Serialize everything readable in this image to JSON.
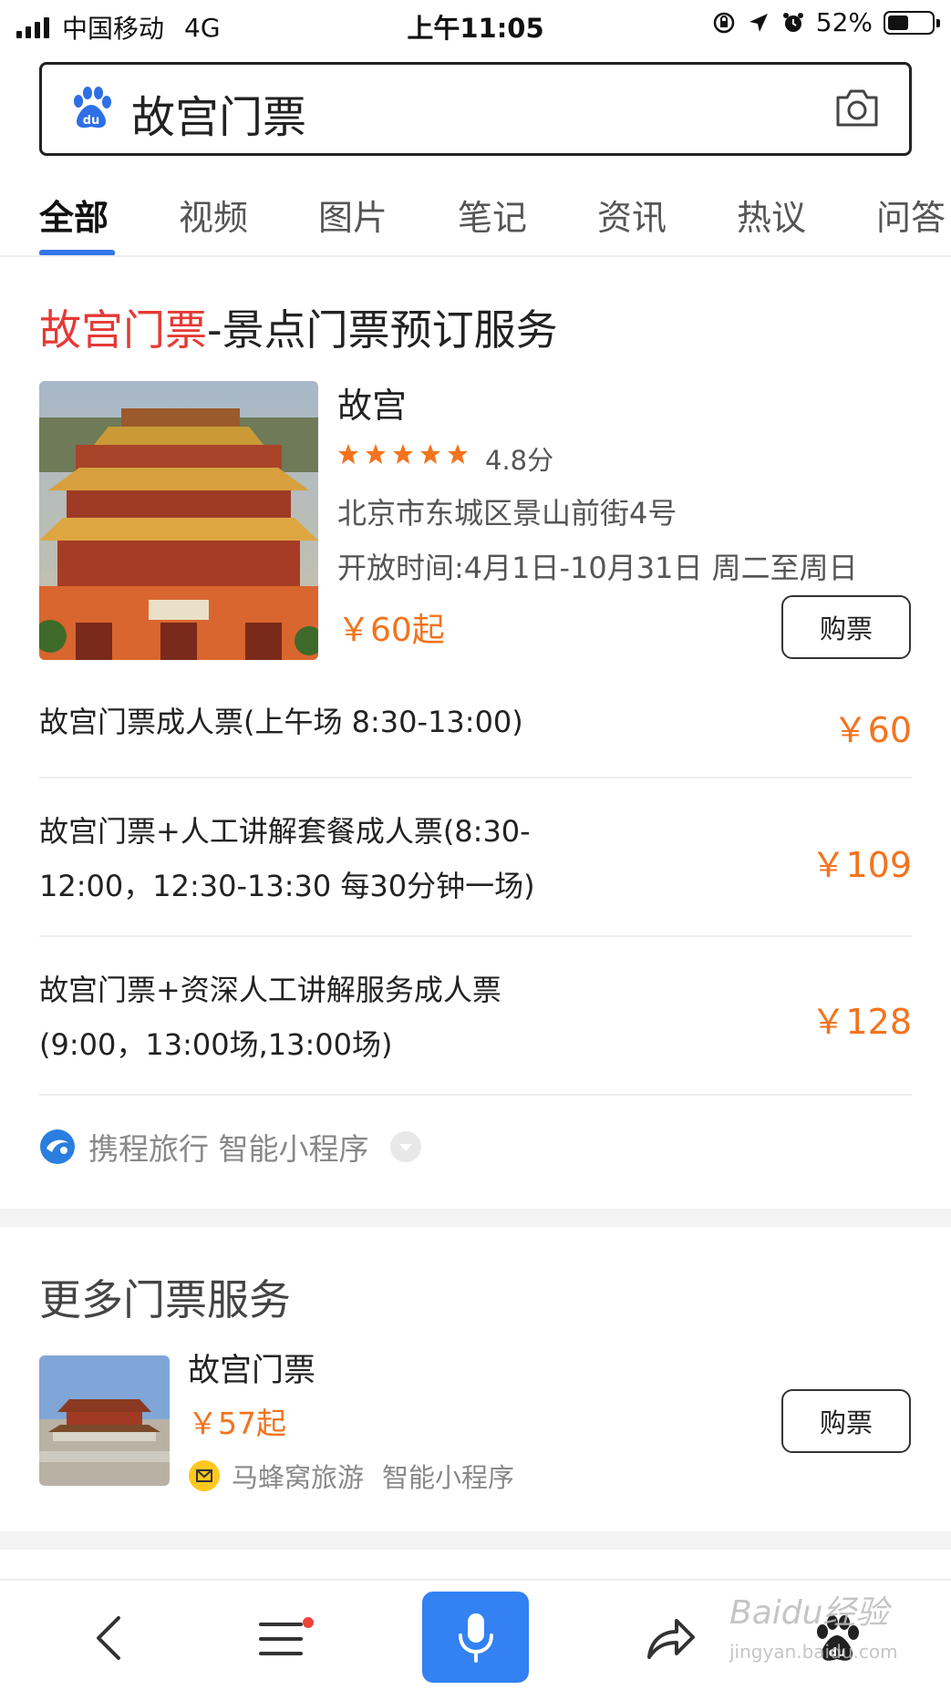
{
  "status_bar": {
    "carrier": "中国移动",
    "network": "4G",
    "time": "上午11:05",
    "battery": "52%"
  },
  "search": {
    "query": "故宫门票",
    "logo_icon": "baidu-paw-icon",
    "camera_icon": "camera-icon"
  },
  "tabs": [
    {
      "label": "全部",
      "active": true
    },
    {
      "label": "视频"
    },
    {
      "label": "图片"
    },
    {
      "label": "笔记"
    },
    {
      "label": "资讯"
    },
    {
      "label": "热议"
    },
    {
      "label": "问答"
    }
  ],
  "main_card": {
    "title_highlight": "故宫门票",
    "title_rest": "-景点门票预订服务",
    "attraction": {
      "name": "故宫",
      "rating": "4.8分",
      "stars": 5,
      "address": "北京市东城区景山前街4号",
      "hours": "开放时间:4月1日-10月31日 周二至周日",
      "price_from": "￥60起",
      "buy_label": "购票"
    },
    "tickets": [
      {
        "name": "故宫门票成人票(上午场 8:30-13:00)",
        "price": "￥60"
      },
      {
        "name": "故宫门票+人工讲解套餐成人票(8:30-12:00，12:30-13:30 每30分钟一场)",
        "price": "￥109"
      },
      {
        "name": "故宫门票+资深人工讲解服务成人票(9:00，13:00场,13:00场)",
        "price": "￥128"
      }
    ],
    "provider": "携程旅行 智能小程序"
  },
  "more_section": {
    "title": "更多门票服务",
    "item": {
      "name": "故宫门票",
      "price_from": "￥57起",
      "provider": "马蜂窝旅游",
      "provider_tag": "智能小程序",
      "buy_label": "购票"
    }
  },
  "watermark": {
    "text": "Baidu经验",
    "sub": "jingyan.baidu.com"
  },
  "colors": {
    "accent_blue": "#3476e8",
    "price_orange": "#f3731e",
    "highlight_red": "#e53935"
  }
}
